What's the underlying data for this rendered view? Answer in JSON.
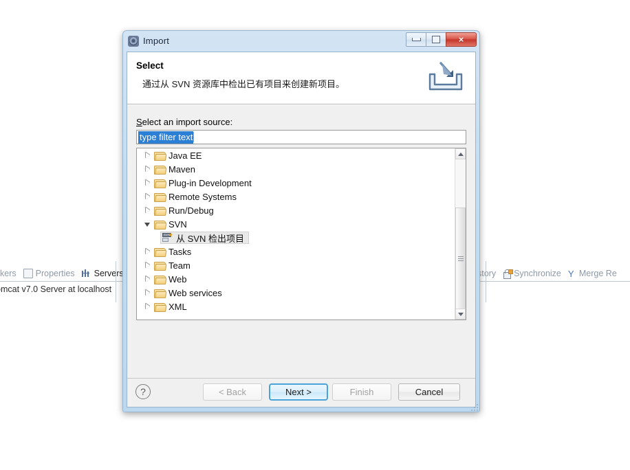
{
  "background": {
    "left_tabs": [
      {
        "label": "kers",
        "icon": "marker-icon",
        "active": false
      },
      {
        "label": "Properties",
        "icon": "properties-icon",
        "active": false
      },
      {
        "label": "Servers",
        "icon": "servers-icon",
        "active": true
      }
    ],
    "right_tabs": [
      {
        "label": "story",
        "icon": "history-icon",
        "active": false
      },
      {
        "label": "Synchronize",
        "icon": "synchronize-icon",
        "active": false
      },
      {
        "label": "Merge Re",
        "icon": "merge-icon",
        "active": false
      }
    ],
    "status_row": "omcat v7.0 Server at localhost"
  },
  "dialog": {
    "title": "Import",
    "title_icon": "import-gear-icon",
    "window_buttons": {
      "minimize": "minimize-icon",
      "maximize": "maximize-icon",
      "close": "×"
    },
    "header": {
      "title": "Select",
      "description": "通过从 SVN 资源库中检出已有项目来创建新项目。",
      "banner_icon": "import-wizard-icon"
    },
    "body": {
      "source_label_mnemonic": "S",
      "source_label_rest": "elect an import source:",
      "filter": {
        "value": "type filter text",
        "placeholder": "type filter text",
        "selected": true
      },
      "tree": [
        {
          "label": "Java EE",
          "type": "folder",
          "state": "collapsed",
          "depth": 0,
          "selected": false
        },
        {
          "label": "Maven",
          "type": "folder",
          "state": "collapsed",
          "depth": 0,
          "selected": false
        },
        {
          "label": "Plug-in Development",
          "type": "folder",
          "state": "collapsed",
          "depth": 0,
          "selected": false
        },
        {
          "label": "Remote Systems",
          "type": "folder",
          "state": "collapsed",
          "depth": 0,
          "selected": false
        },
        {
          "label": "Run/Debug",
          "type": "folder",
          "state": "collapsed",
          "depth": 0,
          "selected": false
        },
        {
          "label": "SVN",
          "type": "folder",
          "state": "expanded",
          "depth": 0,
          "selected": false
        },
        {
          "label": "从 SVN 检出项目",
          "type": "leaf",
          "state": "none",
          "depth": 1,
          "selected": true
        },
        {
          "label": "Tasks",
          "type": "folder",
          "state": "collapsed",
          "depth": 0,
          "selected": false
        },
        {
          "label": "Team",
          "type": "folder",
          "state": "collapsed",
          "depth": 0,
          "selected": false
        },
        {
          "label": "Web",
          "type": "folder",
          "state": "collapsed",
          "depth": 0,
          "selected": false
        },
        {
          "label": "Web services",
          "type": "folder",
          "state": "collapsed",
          "depth": 0,
          "selected": false
        },
        {
          "label": "XML",
          "type": "folder",
          "state": "collapsed",
          "depth": 0,
          "selected": false
        }
      ],
      "scrollbar": {
        "up": "scroll-up-icon",
        "down": "scroll-down-icon"
      }
    },
    "buttons": {
      "help": "?",
      "back": "< Back",
      "back_mnemonic": "B",
      "next": "Next >",
      "finish": "Finish",
      "finish_mnemonic": "F",
      "cancel": "Cancel",
      "back_enabled": false,
      "next_enabled": true,
      "finish_enabled": false,
      "cancel_enabled": true
    }
  },
  "colors": {
    "accent": "#2b7fd4",
    "default_button_border": "#4aa3d8",
    "close_button": "#c6372b",
    "folder": "#f3cf7e"
  }
}
